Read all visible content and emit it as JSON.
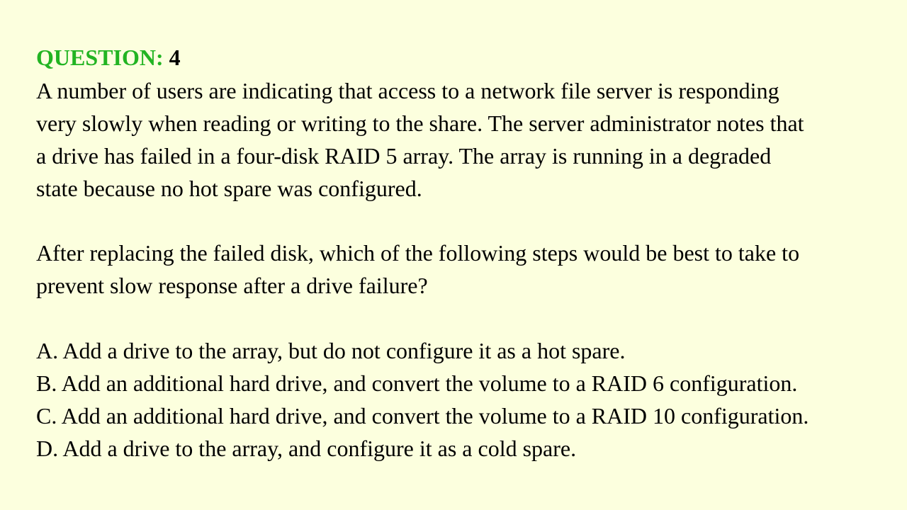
{
  "question": {
    "label": "QUESTION:",
    "number": "4",
    "label_color": "#22b422",
    "background_color": "#fcffde",
    "stem_lines": [
      "A number of users are indicating that access to a network file server is responding",
      "very slowly when reading or writing to the share. The server administrator notes that",
      "a drive has failed in a four-disk RAID 5 array. The array is running in a degraded",
      "state because no hot spare was configured."
    ],
    "prompt_lines": [
      "After replacing the failed disk, which of the following steps would be best to take to",
      "prevent slow response after a drive failure?"
    ],
    "options": [
      {
        "letter": "A",
        "text": "A. Add a drive to the array, but do not configure it as a hot spare."
      },
      {
        "letter": "B",
        "text": "B. Add an additional hard drive, and convert the volume to a RAID 6 configuration."
      },
      {
        "letter": "C",
        "text": "C. Add an additional hard drive, and convert the volume to a RAID 10 configuration."
      },
      {
        "letter": "D",
        "text": "D. Add a drive to the array, and configure it as a cold spare."
      }
    ]
  }
}
